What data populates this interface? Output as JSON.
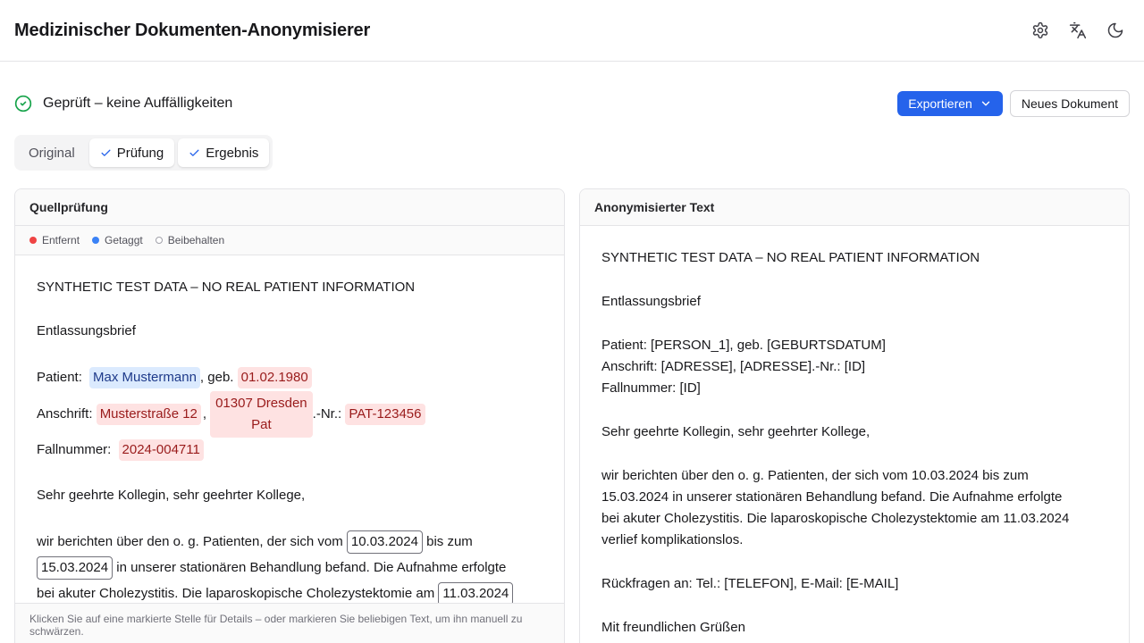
{
  "header": {
    "title": "Medizinischer Dokumenten-Anonymisierer",
    "icons": [
      "gear-icon",
      "translate-icon",
      "moon-icon"
    ]
  },
  "status": {
    "text": "Geprüft – keine Auffälligkeiten",
    "export_label": "Exportieren",
    "new_doc_label": "Neues Dokument"
  },
  "tabs": [
    {
      "label": "Original",
      "active": false
    },
    {
      "label": "Prüfung",
      "active": true
    },
    {
      "label": "Ergebnis",
      "active": true
    }
  ],
  "left_panel": {
    "title": "Quellprüfung",
    "legend": {
      "removed": "Entfernt",
      "tagged": "Getaggt",
      "kept": "Beibehalten"
    },
    "line1": "SYNTHETIC TEST DATA – NO REAL PATIENT INFORMATION",
    "line2": "Entlassungsbrief",
    "patient_prefix": "Patient: ",
    "patient_name": "Max Mustermann",
    "patient_mid": ", geb. ",
    "patient_dob": "01.02.1980",
    "address_prefix": "Anschrift: ",
    "address_street": "Musterstraße 12",
    "address_comma": ",",
    "address_city_l1": "01307 Dresden",
    "address_city_l2": "Pat",
    "address_mid": ".-Nr.: ",
    "address_patid": "PAT-123456",
    "case_prefix": "Fallnummer: ",
    "case_id": "2024-004711",
    "greeting": "Sehr geehrte Kollegin, sehr geehrter Kollege,",
    "body_a": "wir berichten über den o. g. Patienten, der sich vom ",
    "date1": "10.03.2024",
    "body_b": " bis zum",
    "date2": "15.03.2024",
    "body_c": " in unserer stationären Behandlung befand. Die Aufnahme erfolgte",
    "body_d": "bei akuter Cholezystitis. Die laparoskopische Cholezystektomie am ",
    "date3": "11.03.2024",
    "footer": "Klicken Sie auf eine markierte Stelle für Details – oder markieren Sie beliebigen Text, um ihn manuell zu schwärzen."
  },
  "right_panel": {
    "title": "Anonymisierter Text",
    "lines": [
      "SYNTHETIC TEST DATA – NO REAL PATIENT INFORMATION",
      "",
      "Entlassungsbrief",
      "",
      "Patient: [PERSON_1], geb. [GEBURTSDATUM]",
      "Anschrift: [ADRESSE], [ADRESSE].-Nr.: [ID]",
      "Fallnummer: [ID]",
      "",
      "Sehr geehrte Kollegin, sehr geehrter Kollege,",
      "",
      "wir berichten über den o. g. Patienten, der sich vom 10.03.2024 bis zum",
      "15.03.2024 in unserer stationären Behandlung befand. Die Aufnahme erfolgte",
      "bei akuter Cholezystitis. Die laparoskopische Cholezystektomie am 11.03.2024",
      "verlief komplikationslos.",
      "",
      "Rückfragen an: Tel.: [TELEFON], E-Mail: [E-MAIL]",
      "",
      "Mit freundlichen Grüßen"
    ]
  },
  "colors": {
    "accent": "#2563eb",
    "success": "#16a34a",
    "removed": "#ef4444",
    "tagged": "#3b82f6"
  }
}
